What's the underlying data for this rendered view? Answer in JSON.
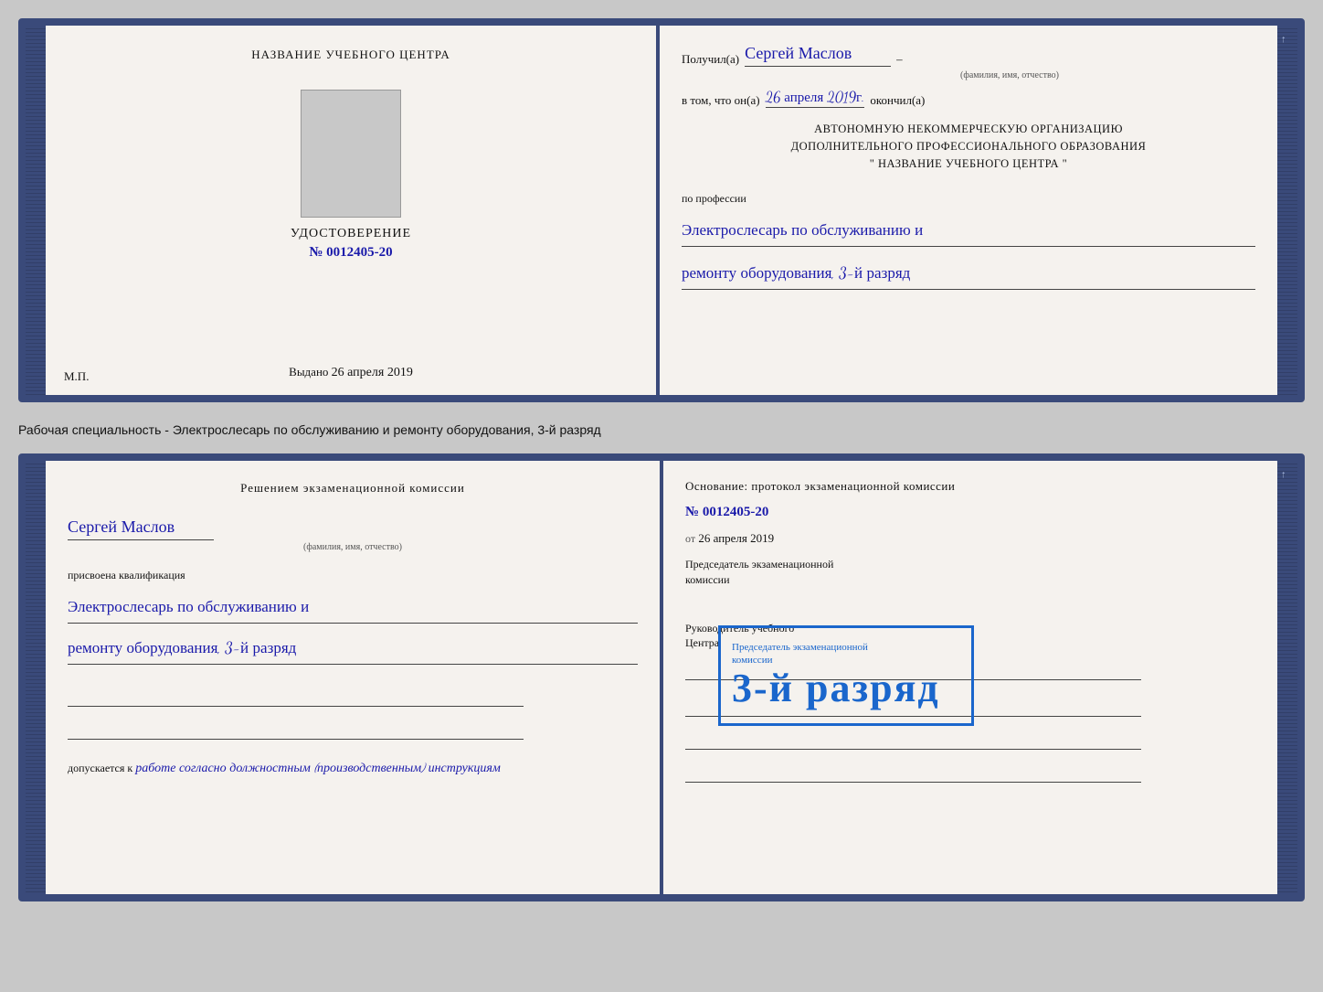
{
  "top_doc": {
    "left": {
      "title": "НАЗВАНИЕ УЧЕБНОГО ЦЕНТРА",
      "udostoverenie": "УДОСТОВЕРЕНИЕ",
      "number_prefix": "№",
      "number": "0012405-20",
      "vydano_prefix": "Выдано",
      "vydano_date": "26 апреля 2019",
      "mp_label": "М.П."
    },
    "right": {
      "poluchil_label": "Получил(а)",
      "recipient_name": "Сергей Маслов",
      "fio_label": "(фамилия, имя, отчество)",
      "dash": "–",
      "vtom_label": "в том, что он(а)",
      "vtom_date": "26 апреля 2019г.",
      "okonchil_label": "окончил(а)",
      "org_line1": "АВТОНОМНУЮ НЕКОММЕРЧЕСКУЮ ОРГАНИЗАЦИЮ",
      "org_line2": "ДОПОЛНИТЕЛЬНОГО ПРОФЕССИОНАЛЬНОГО ОБРАЗОВАНИЯ",
      "org_line3": "\"   НАЗВАНИЕ УЧЕБНОГО ЦЕНТРА   \"",
      "profesia_label": "по профессии",
      "profesia_line1": "Электрослесарь по обслуживанию и",
      "profesia_line2": "ремонту оборудования, 3-й разряд"
    }
  },
  "between_text": "Рабочая специальность - Электрослесарь по обслуживанию и ремонту оборудования, 3-й разряд",
  "bottom_doc": {
    "left": {
      "resheniye_title": "Решением  экзаменационной  комиссии",
      "name": "Сергей Маслов",
      "fio_label": "(фамилия, имя, отчество)",
      "prisvoena_label": "присвоена квалификация",
      "kvali_line1": "Электрослесарь по обслуживанию и",
      "kvali_line2": "ремонту оборудования, 3-й разряд",
      "dopuskaetsya_prefix": "допускается к",
      "dopuskaetsya_text": "работе согласно должностным (производственным) инструкциям"
    },
    "right": {
      "osnovanie_label": "Основание: протокол экзаменационной  комиссии",
      "number_prefix": "№",
      "number": "0012405-20",
      "ot_prefix": "от",
      "ot_date": "26 апреля 2019",
      "predsed_line1": "Председатель экзаменационной",
      "predsed_line2": "комиссии",
      "rukovod_line1": "Руководитель учебного",
      "rukovod_line2": "Центра"
    },
    "stamp": {
      "line1": "Председатель экзаменационной",
      "line2": "комиссии",
      "big_text": "3-й разряд"
    }
  }
}
